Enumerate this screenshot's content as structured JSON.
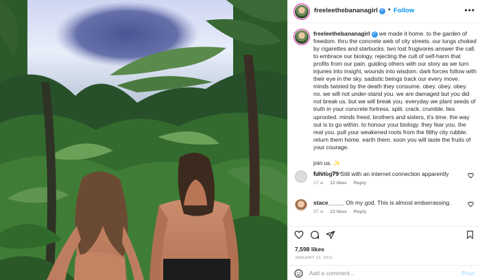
{
  "post": {
    "username": "freeleethebananagirl",
    "follow_label": "Follow",
    "separator": "•",
    "more_label": "•••",
    "caption": "we made it home. to the garden of freedom. thru the concrete web of city streets. our lungs choked by cigarettes and starbucks. two lost frugivores answer the call. to embrace our biology. rejecting the cult of self-harm that profits from our pain. guiding others with our story as we turn injuries into insight, wounds into wisdom. dark forces follow with their eye in the sky. sadistic beings track our every move. minds twisted by the death they consume. obey. obey. obey. no. we will not under-stand you. we are damaged but you did not break us. but we will break you. everyday we plant seeds of truth in your concrete fortress. split. crack. crumble. lies uprooted. minds freed. brothers and sisters, it's time. the way out is to go within. to honour your biology. they fear you. the real you. pull your weakened roots from the filthy city rubble. return them home. earth them. soon you will taste the fruits of your courage.",
    "join_text": "join us.",
    "sparkle": "✨",
    "caption_meta": "Edited · 67 w",
    "likes": "7,598 likes",
    "date": "JANUARY 12, 2021"
  },
  "comments": [
    {
      "username": "fulviog79",
      "text": "Still with an internet connection apparently",
      "age": "27 w",
      "likes": "12 likes",
      "reply_label": "Reply"
    },
    {
      "username": "stace_____",
      "text": "Oh my god. This is almost embarrassing.",
      "age": "37 w",
      "likes": "12 likes",
      "reply_label": "Reply"
    }
  ],
  "add_comment": {
    "placeholder": "Add a comment...",
    "post_label": "Post"
  },
  "icons": {
    "verified": "verified-badge-icon",
    "like": "heart-icon",
    "comment": "comment-bubble-icon",
    "share": "paper-plane-icon",
    "save": "bookmark-icon",
    "emoji": "smiley-icon"
  },
  "colors": {
    "accent": "#0095f6",
    "post_disabled": "#b2dffc",
    "muted": "#8e8e8e",
    "verified": "#3897f0"
  }
}
